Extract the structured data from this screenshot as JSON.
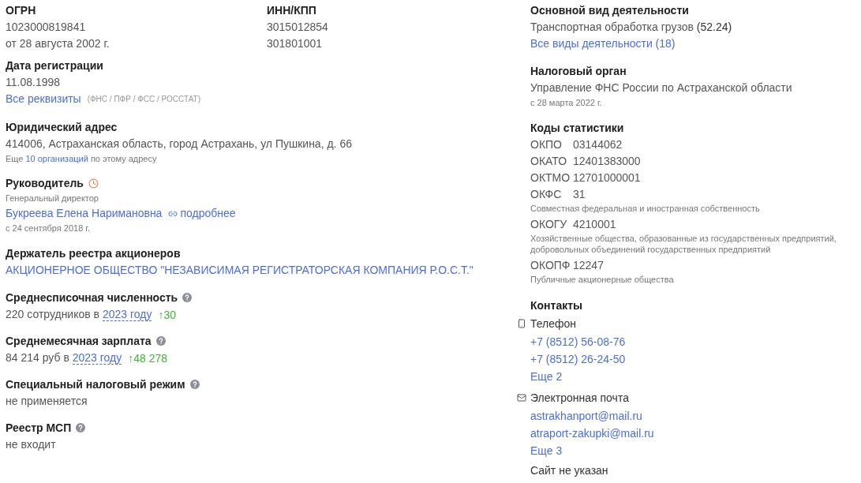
{
  "ogrn": {
    "label": "ОГРН",
    "value": "1023000819841",
    "date": "от 28 августа 2002 г."
  },
  "inn_kpp": {
    "label": "ИНН/КПП",
    "values": [
      "3015012854",
      "301801001"
    ]
  },
  "registration": {
    "label": "Дата регистрации",
    "value": "11.08.1998",
    "link": "Все реквизиты",
    "note": "(ФНС / ПФР / ФСС / РОССТАТ)"
  },
  "address": {
    "label": "Юридический адрес",
    "value": "414006, Астраханская область, город Астрахань, ул Пушкина, д. 66",
    "note_before": "Еще",
    "note_link": "10 организаций",
    "note_after": "по этому адресу"
  },
  "director": {
    "label": "Руководитель",
    "position": "Генеральный директор",
    "name": "Букреева Елена Наримановна",
    "more": "подробнее",
    "since": "с 24 сентября 2018 г."
  },
  "registry_holder": {
    "label": "Держатель реестра акционеров",
    "value": "АКЦИОНЕРНОЕ ОБЩЕСТВО \"НЕЗАВИСИМАЯ РЕГИСТРАТОРСКАЯ КОМПАНИЯ Р.О.С.Т.\""
  },
  "headcount": {
    "label": "Среднесписочная численность",
    "prefix": "220 сотрудников в",
    "year": "2023 году",
    "change": "↑30"
  },
  "salary": {
    "label": "Среднемесячная зарплата",
    "prefix": "84 214 руб в",
    "year": "2023 году",
    "change": "↑48 278"
  },
  "tax_regime": {
    "label": "Специальный налоговый режим",
    "value": "не применяется"
  },
  "msp": {
    "label": "Реестр МСП",
    "value": "не входит"
  },
  "activity": {
    "label": "Основной вид деятельности",
    "value": "Транспортная обработка грузов",
    "code": "(52.24)",
    "link": "Все виды деятельности (18)"
  },
  "tax_authority": {
    "label": "Налоговый орган",
    "value": "Управление ФНС России по Астраханской области",
    "since": "с 28 марта 2022 г."
  },
  "stat_codes": {
    "label": "Коды статистики",
    "items": [
      {
        "code": "ОКПО",
        "value": "03144062"
      },
      {
        "code": "ОКАТО",
        "value": "12401383000"
      },
      {
        "code": "ОКТМО",
        "value": "12701000001"
      },
      {
        "code": "ОКФС",
        "value": "31",
        "note": "Совместная федеральная и иностранная собственность"
      },
      {
        "code": "ОКОГУ",
        "value": "4210001",
        "note": "Хозяйственные общества, образованные из государственных предприятий, добровольных объединений государственных предприятий"
      },
      {
        "code": "ОКОПФ",
        "value": "12247",
        "note": "Публичные акционерные общества"
      }
    ]
  },
  "contacts": {
    "label": "Контакты",
    "groups": [
      {
        "kind": "phone",
        "label": "Телефон",
        "items": [
          "+7 (8512) 56-08-76",
          "+7 (8512) 26-24-50"
        ],
        "more": "Еще 2"
      },
      {
        "kind": "email",
        "label": "Электронная почта",
        "items": [
          "astrakhanport@mail.ru",
          "atraport-zakupki@mail.ru"
        ],
        "more": "Еще 3"
      }
    ],
    "site": "Сайт не указан"
  }
}
